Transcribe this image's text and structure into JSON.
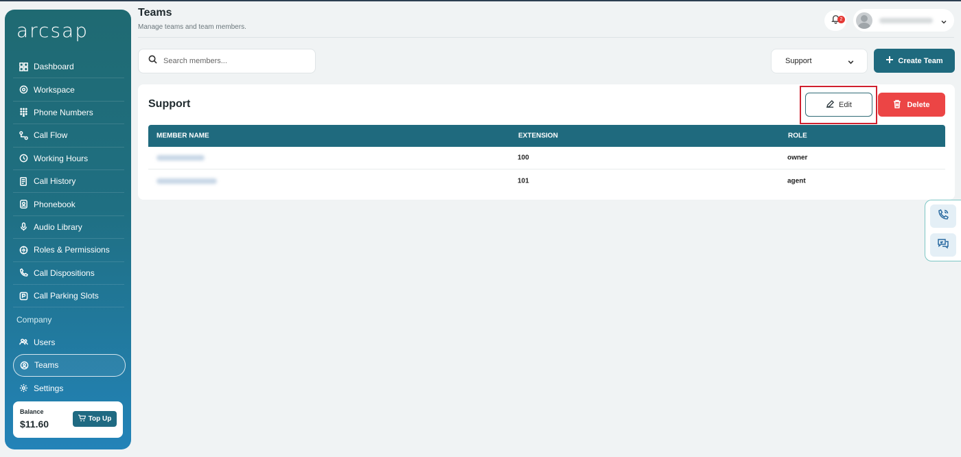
{
  "app": {
    "logo_text": "arcsap"
  },
  "sidebar": {
    "items": [
      {
        "label": "Dashboard",
        "icon": "grid-icon"
      },
      {
        "label": "Workspace",
        "icon": "workspace-icon"
      },
      {
        "label": "Phone Numbers",
        "icon": "dialpad-icon"
      },
      {
        "label": "Call Flow",
        "icon": "flow-icon"
      },
      {
        "label": "Working Hours",
        "icon": "clock-icon"
      },
      {
        "label": "Call History",
        "icon": "history-icon"
      },
      {
        "label": "Phonebook",
        "icon": "phonebook-icon"
      },
      {
        "label": "Audio Library",
        "icon": "microphone-icon"
      },
      {
        "label": "Roles & Permissions",
        "icon": "shield-icon"
      },
      {
        "label": "Call Dispositions",
        "icon": "phone-icon"
      },
      {
        "label": "Call Parking Slots",
        "icon": "parking-icon"
      }
    ],
    "section_label": "Company",
    "company_items": [
      {
        "label": "Users",
        "icon": "users-icon"
      },
      {
        "label": "Teams",
        "icon": "teams-icon",
        "active": true
      },
      {
        "label": "Settings",
        "icon": "gear-icon"
      }
    ],
    "balance": {
      "label": "Balance",
      "value": "$11.60",
      "topup_label": "Top Up"
    }
  },
  "header": {
    "title": "Teams",
    "subtitle": "Manage teams and team members.",
    "notification_count": "2"
  },
  "toolbar": {
    "search_placeholder": "Search members...",
    "team_select_value": "Support",
    "create_label": "Create Team"
  },
  "team_card": {
    "title": "Support",
    "edit_label": "Edit",
    "delete_label": "Delete",
    "columns": [
      "MEMBER NAME",
      "EXTENSION",
      "ROLE"
    ],
    "rows": [
      {
        "extension": "100",
        "role": "owner"
      },
      {
        "extension": "101",
        "role": "agent"
      }
    ]
  },
  "colors": {
    "primary": "#1f6a7e",
    "danger": "#ec4545",
    "highlight_border": "#d0202e"
  }
}
